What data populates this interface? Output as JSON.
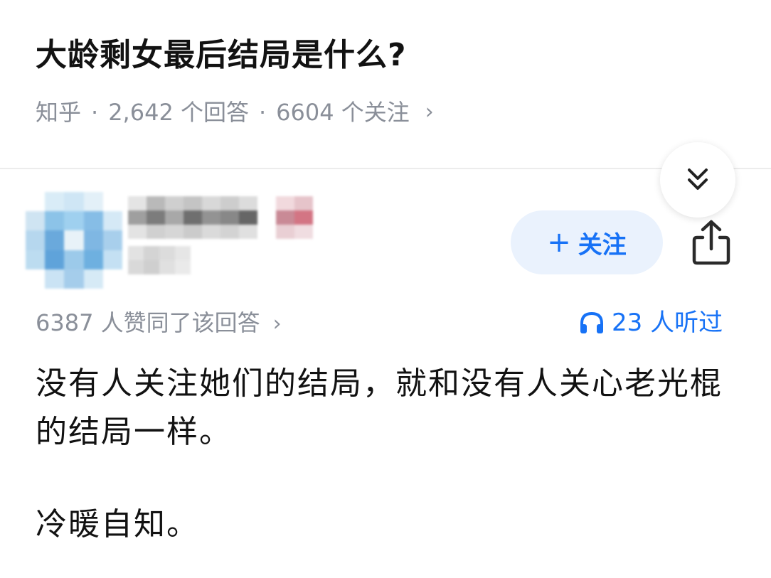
{
  "question": {
    "title": "大龄剩女最后结局是什么?",
    "source": "知乎",
    "answers": "2,642 个回答",
    "followers": "6604 个关注"
  },
  "author": {
    "follow_label": "关注"
  },
  "answer": {
    "votes": "6387 人赞同了该回答",
    "listens": "23 人听过",
    "paragraphs": [
      "没有人关注她们的结局，就和没有人关心老光棍的结局一样。",
      "冷暖自知。"
    ]
  },
  "colors": {
    "accent": "#1772f6",
    "follow_bg": "#eaf2fd",
    "meta_gray": "#8a8f99"
  },
  "icons": {
    "collapse": "double-chevron-down-icon",
    "share": "share-icon",
    "listen": "headphones-icon",
    "chevron": "chevron-right-icon"
  }
}
